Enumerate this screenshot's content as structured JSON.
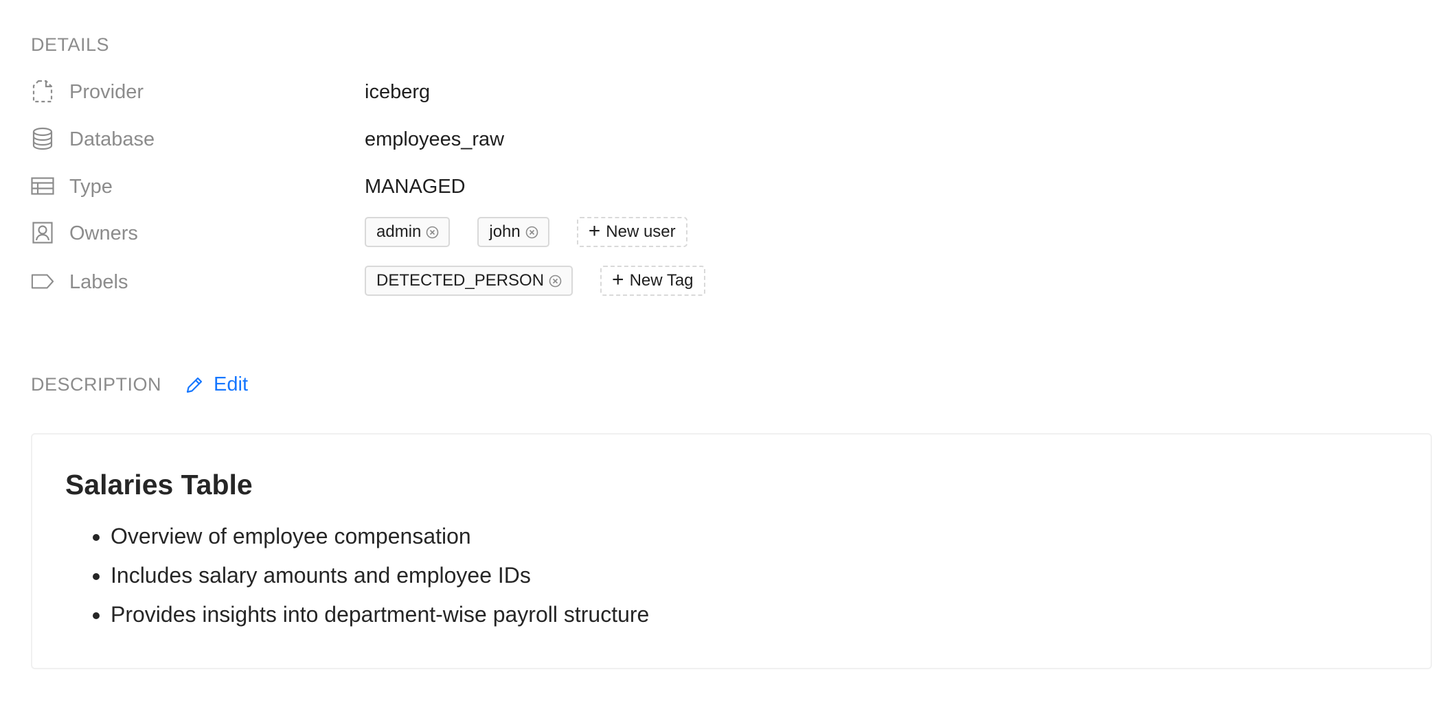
{
  "details": {
    "title": "DETAILS",
    "provider": {
      "label": "Provider",
      "value": "iceberg",
      "icon": "file-dashed-icon"
    },
    "database": {
      "label": "Database",
      "value": "employees_raw",
      "icon": "database-icon"
    },
    "type": {
      "label": "Type",
      "value": "MANAGED",
      "icon": "table-icon"
    },
    "owners": {
      "label": "Owners",
      "icon": "contacts-icon",
      "items": [
        "admin",
        "john"
      ],
      "add_label": "New user"
    },
    "labels": {
      "label": "Labels",
      "icon": "tag-icon",
      "items": [
        "DETECTED_PERSON"
      ],
      "add_label": "New Tag"
    }
  },
  "description": {
    "title": "DESCRIPTION",
    "edit_label": "Edit",
    "heading": "Salaries Table",
    "bullets": [
      "Overview of employee compensation",
      "Includes salary amounts and employee IDs",
      "Provides insights into department-wise payroll structure"
    ]
  },
  "colors": {
    "muted_text": "#8c8c8c",
    "link": "#1677ff",
    "tag_border": "#d9d9d9",
    "card_border": "#f0f0f0"
  }
}
